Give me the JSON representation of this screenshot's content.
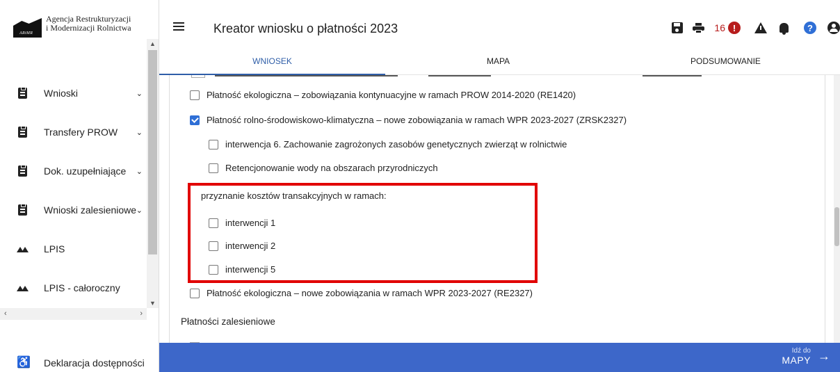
{
  "logo": {
    "line1": "Agencja Restrukturyzacji",
    "line2": "i Modernizacji Rolnictwa",
    "mark_text": "ARiMR"
  },
  "sidebar": {
    "items": [
      {
        "label": "Wnioski",
        "icon": "clipboard-icon",
        "chevron": "⌄"
      },
      {
        "label": "Transfery PROW",
        "icon": "clipboard-icon",
        "chevron": "⌄"
      },
      {
        "label": "Dok. uzupełniające",
        "icon": "clipboard-icon",
        "chevron": "⌄"
      },
      {
        "label": "Wnioski zalesieniowe",
        "icon": "clipboard-icon",
        "chevron": "⌄"
      },
      {
        "label": "LPIS",
        "icon": "terrain-icon"
      },
      {
        "label": "LPIS - całoroczny",
        "icon": "terrain-icon"
      }
    ],
    "accessibility": {
      "label": "Deklaracja dostępności",
      "icon": "accessibility-icon"
    }
  },
  "header": {
    "title": "Kreator wniosku o płatności 2023",
    "error_count": "16",
    "tabs": [
      {
        "label": "WNIOSEK",
        "active": true
      },
      {
        "label": "MAPA",
        "active": false
      },
      {
        "label": "PODSUMOWANIE",
        "active": false
      }
    ]
  },
  "form": {
    "options": [
      {
        "label": "Płatność ekologiczna – zobowiązania kontynuacyjne w ramach PROW 2014-2020 (RE1420)",
        "checked": false
      },
      {
        "label": "Płatność rolno-środowiskowo-klimatyczna – nowe zobowiązania w ramach WPR 2023-2027 (ZRSK2327)",
        "checked": true
      },
      {
        "label": "interwencja 6. Zachowanie zagrożonych zasobów genetycznych zwierząt w rolnictwie",
        "checked": false
      },
      {
        "label": "Retencjonowanie wody na obszarach przyrodniczych",
        "checked": false
      }
    ],
    "transaction_heading": "przyznanie kosztów transakcyjnych w ramach:",
    "transaction_options": [
      {
        "label": "interwencji 1",
        "checked": false
      },
      {
        "label": "interwencji 2",
        "checked": false
      },
      {
        "label": "interwencji 5",
        "checked": false
      }
    ],
    "eco_new": {
      "label": "Płatność ekologiczna – nowe zobowiązania w ramach WPR 2023-2027 (RE2327)",
      "checked": false
    },
    "section_heading": "Płatności zalesieniowe"
  },
  "footer": {
    "goto_small": "Idź do",
    "goto_big": "MAPY"
  },
  "colors": {
    "accent": "#3d67c9",
    "highlight": "#e10000",
    "error": "#b71c1c",
    "checkbox_checked": "#2f6fd6"
  }
}
